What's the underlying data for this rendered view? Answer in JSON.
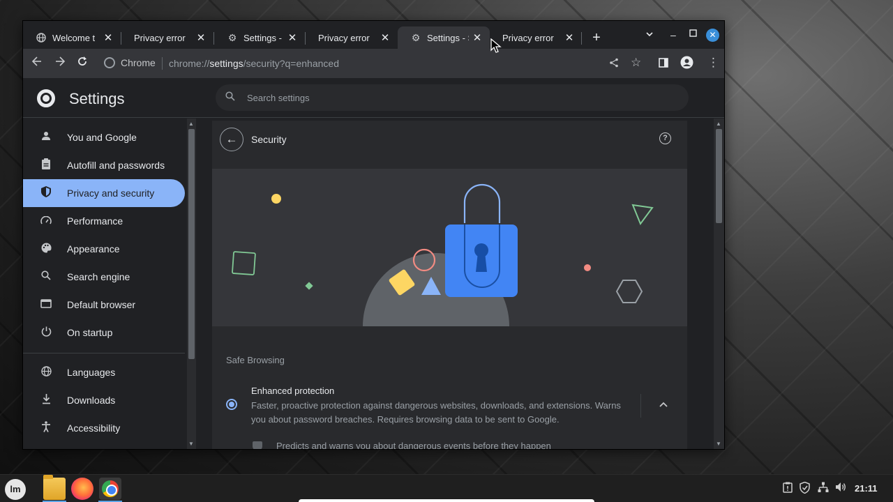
{
  "browser": {
    "tabs": [
      {
        "title": "Welcome t",
        "icon": "globe-icon"
      },
      {
        "title": "Privacy error",
        "icon": "none"
      },
      {
        "title": "Settings - S",
        "icon": "gear-icon"
      },
      {
        "title": "Privacy error",
        "icon": "none"
      },
      {
        "title": "Settings - S",
        "icon": "gear-icon",
        "active": true
      },
      {
        "title": "Privacy error",
        "icon": "none"
      }
    ],
    "omnibox": {
      "site_label": "Chrome",
      "url_prefix": "chrome://",
      "url_host": "settings",
      "url_rest": "/security?q=enhanced"
    }
  },
  "settings": {
    "title": "Settings",
    "search_placeholder": "Search settings",
    "nav": [
      {
        "label": "You and Google",
        "icon": "person-icon"
      },
      {
        "label": "Autofill and passwords",
        "icon": "clipboard-icon"
      },
      {
        "label": "Privacy and security",
        "icon": "shield-icon",
        "active": true
      },
      {
        "label": "Performance",
        "icon": "speedometer-icon"
      },
      {
        "label": "Appearance",
        "icon": "palette-icon"
      },
      {
        "label": "Search engine",
        "icon": "search-icon"
      },
      {
        "label": "Default browser",
        "icon": "browser-icon"
      },
      {
        "label": "On startup",
        "icon": "power-icon"
      },
      {
        "label": "Languages",
        "icon": "globe-icon"
      },
      {
        "label": "Downloads",
        "icon": "download-icon"
      },
      {
        "label": "Accessibility",
        "icon": "accessibility-icon"
      }
    ]
  },
  "security": {
    "page_title": "Security",
    "section_title": "Safe Browsing",
    "option": {
      "title": "Enhanced protection",
      "description": "Faster, proactive protection against dangerous websites, downloads, and extensions. Warns you about password breaches. Requires browsing data to be sent to Google.",
      "selected": true,
      "expanded": true
    },
    "sub_item": "Predicts and warns you about dangerous events before they happen"
  },
  "taskbar": {
    "apps": [
      "files-icon",
      "firefox-icon",
      "chrome-icon"
    ],
    "tray": [
      "clipboard-icon",
      "shield-icon",
      "network-icon",
      "volume-icon"
    ],
    "clock": "21:11"
  },
  "colors": {
    "accent": "#8ab4f8",
    "lock_blue": "#4285f4",
    "background": "#202124"
  }
}
